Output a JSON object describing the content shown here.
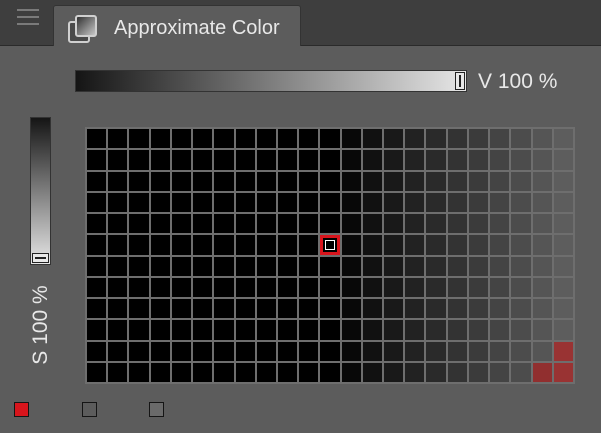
{
  "panel": {
    "title": "Approximate Color",
    "tab_icon": "approximate-color-icon",
    "menu_icon": "hamburger-menu-icon"
  },
  "value_slider": {
    "label": "V 100 %",
    "value_percent": 100
  },
  "saturation_slider": {
    "label": "S 100 %",
    "value_percent": 100
  },
  "palette": {
    "rows": 12,
    "columns": 23,
    "selected_cell": {
      "row": 5,
      "column": 11
    },
    "accent_color": "#d8151c",
    "tinted_cells": [
      {
        "row": 10,
        "column": 22
      },
      {
        "row": 11,
        "column": 21
      },
      {
        "row": 11,
        "column": 22
      }
    ]
  },
  "swatches": [
    {
      "name": "foreground",
      "color": "#d8151c"
    },
    {
      "name": "transparent-1",
      "color": "#5c5c5c"
    },
    {
      "name": "transparent-2",
      "color": "#6a6a6a"
    }
  ]
}
